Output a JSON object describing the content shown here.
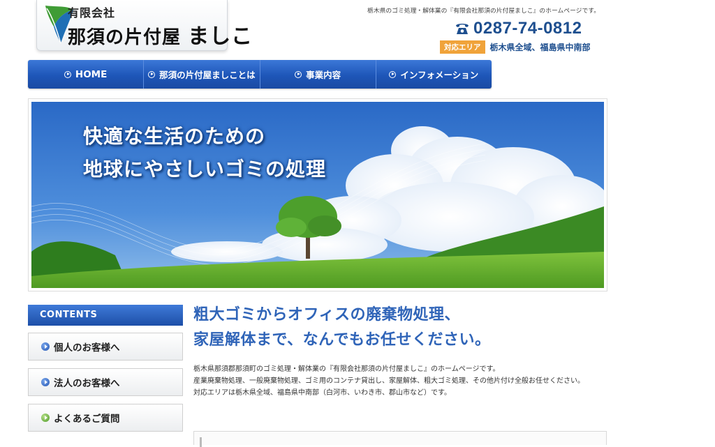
{
  "header": {
    "tagline": "栃木県のゴミ処理・解体業の『有限会社那須の片付屋ましこ』のホームページです。",
    "logo": {
      "company_type": "有限会社",
      "name_prefix": "那須の片付屋",
      "name_suffix": "ましこ"
    },
    "phone": "0287-74-0812",
    "service_area_label": "対応エリア",
    "service_area": "栃木県全域、福島県中南部"
  },
  "nav": {
    "items": [
      {
        "label": "HOME",
        "icon": "circle-arrow-icon"
      },
      {
        "label": "那須の片付屋ましことは",
        "icon": "circle-arrow-icon"
      },
      {
        "label": "事業内容",
        "icon": "circle-arrow-icon"
      },
      {
        "label": "インフォメーション",
        "icon": "circle-arrow-icon"
      }
    ]
  },
  "hero": {
    "line1": "快適な生活のための",
    "line2": "地球にやさしいゴミの処理"
  },
  "sidebar": {
    "heading": "CONTENTS",
    "items": [
      {
        "label": "個人のお客様へ",
        "icon": "blue-bullet-icon"
      },
      {
        "label": "法人のお客様へ",
        "icon": "blue-bullet-icon"
      },
      {
        "label": "よくあるご質問",
        "icon": "green-bullet-icon"
      }
    ]
  },
  "main": {
    "heading_line1": "粗大ゴミからオフィスの廃棄物処理、",
    "heading_line2": "家屋解体まで、なんでもお任せください。",
    "paragraph_line1": "栃木県那須郡那須町のゴミ処理・解体業の『有限会社那須の片付屋ましこ』のホームページです。",
    "paragraph_line2": "産業廃棄物処理、一般廃棄物処理、ゴミ用のコンテナ貸出し、家屋解体、粗大ゴミ処理、その他片付け全般お任せください。",
    "paragraph_line3": "対応エリアは栃木県全域、福島県中南部（白河市、いわき市、郡山市など）です。"
  },
  "colors": {
    "brand_blue": "#1e56b8",
    "heading_blue": "#2f64b8",
    "area_badge": "#f0a33a"
  }
}
